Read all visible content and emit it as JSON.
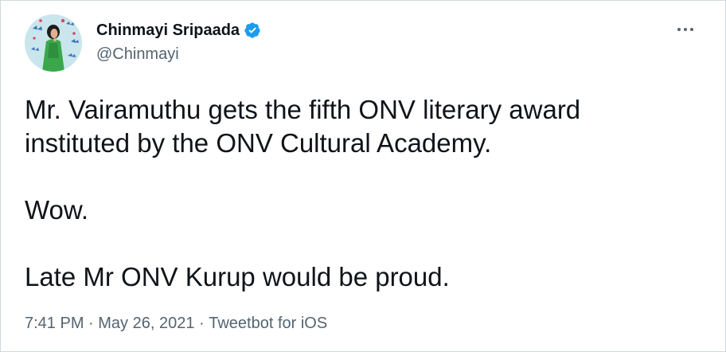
{
  "tweet": {
    "author": {
      "display_name": "Chinmayi Sripaada",
      "handle": "@Chinmayi",
      "verified": true,
      "avatar_icon": "avatar-illustration"
    },
    "text": "Mr. Vairamuthu gets the fifth ONV literary award\ninstituted by the ONV Cultural Academy.\n\nWow.\n\nLate Mr ONV Kurup would be proud.",
    "time": "7:41 PM",
    "date": "May 26, 2021",
    "separator": " · ",
    "source": "Tweetbot for iOS",
    "more_icon": "more-options-icon"
  },
  "colors": {
    "verified_badge": "#1d9bf0",
    "text_primary": "#0f1419",
    "text_secondary": "#536471",
    "border": "#cfd9de",
    "avatar_background": "#c9e6ec"
  }
}
